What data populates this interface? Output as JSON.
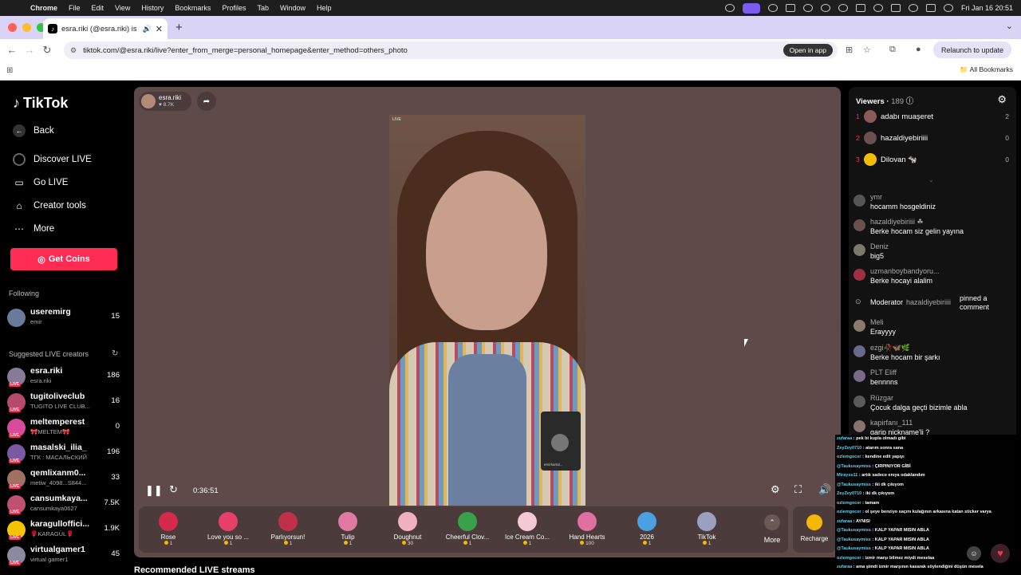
{
  "menubar": {
    "app": "Chrome",
    "items": [
      "File",
      "Edit",
      "View",
      "History",
      "Bookmarks",
      "Profiles",
      "Tab",
      "Window",
      "Help"
    ],
    "clock": "Fri Jan 16  20:51"
  },
  "tab": {
    "title": "esra.riki (@esra.riki) is LIVE"
  },
  "address": {
    "url": "tiktok.com/@esra.riki/live?enter_from_merge=personal_homepage&enter_method=others_photo",
    "open_in_app": "Open in app",
    "relaunch": "Relaunch to update"
  },
  "bookmarks": {
    "all": "All Bookmarks"
  },
  "sidebar": {
    "logo": "TikTok",
    "back": "Back",
    "nav": [
      "Discover LIVE",
      "Go LIVE",
      "Creator tools",
      "More"
    ],
    "get_coins": "Get Coins",
    "following_title": "Following",
    "following": [
      {
        "name": "useremirg",
        "sub": "emir",
        "count": "15"
      }
    ],
    "suggested_title": "Suggested LIVE creators",
    "suggested": [
      {
        "name": "esra.riki",
        "sub": "esra.riki",
        "count": "186"
      },
      {
        "name": "tugitoliveclub",
        "sub": "TUGITO LIVE CLUB...",
        "count": "16"
      },
      {
        "name": "meltemperest",
        "sub": "🎀MELTEM🎀",
        "count": "0"
      },
      {
        "name": "masalski_ilia_",
        "sub": "ТГК : МАСАЛЬСКИЙ",
        "count": "196"
      },
      {
        "name": "qemlixanm0...",
        "sub": "metiw_4098...S844...",
        "count": "33"
      },
      {
        "name": "cansumkaya...",
        "sub": "cansumkaya0627",
        "count": "7.5K"
      },
      {
        "name": "karagulloffici...",
        "sub": "🌹KARAGÜL🌹",
        "count": "1.9K"
      },
      {
        "name": "virtualgamer1",
        "sub": "virtual gamer1",
        "count": "45"
      }
    ],
    "avatar_colors": [
      "#8a7a9a",
      "#b54a6a",
      "#d84a9a",
      "#7a5aa0",
      "#a07060",
      "#c05070",
      "#f5c400",
      "#8a8aa0"
    ]
  },
  "player": {
    "host": {
      "name": "esra.riki",
      "likes": "♥ 8.7K"
    },
    "live_tag": "LIVE",
    "pip_name": "emirkartal...",
    "time": "0:36:51",
    "gifts": [
      {
        "name": "Rose",
        "price": "1",
        "color": "#d62a4a"
      },
      {
        "name": "Love you so ...",
        "price": "1",
        "color": "#e8406a"
      },
      {
        "name": "Parlıyorsun!",
        "price": "1",
        "color": "#c0304a"
      },
      {
        "name": "Tulip",
        "price": "1",
        "color": "#e07aa0"
      },
      {
        "name": "Doughnut",
        "price": "30",
        "color": "#f0b0c0"
      },
      {
        "name": "Cheerful Clov...",
        "price": "1",
        "color": "#3aa04a"
      },
      {
        "name": "Ice Cream Co...",
        "price": "1",
        "color": "#f4c8d4"
      },
      {
        "name": "Hand Hearts",
        "price": "100",
        "color": "#e070a0"
      },
      {
        "name": "2026",
        "price": "1",
        "color": "#4aa0e0"
      },
      {
        "name": "TikTok",
        "price": "1",
        "color": "#9aa0c0"
      }
    ],
    "more": "More",
    "recharge": "Recharge"
  },
  "recommended": "Recommended LIVE streams",
  "viewers_panel": {
    "title": "Viewers",
    "count": "189",
    "top": [
      {
        "rank": "1",
        "name": "adabı muaşeret",
        "score": "2",
        "color": "#8a5a5a"
      },
      {
        "rank": "2",
        "name": "hazaldiyebiriiii",
        "score": "0",
        "color": "#6a5050"
      },
      {
        "rank": "3",
        "name": "Dilovan 🐄",
        "score": "0",
        "color": "#f0c000"
      }
    ],
    "comments": [
      {
        "user": "ymr",
        "text": "hocamm hosgeldiniz",
        "color": "#555"
      },
      {
        "user": "hazaldiyebiriiii ☘",
        "text": "Berke hocam siz gelin yayına",
        "color": "#6a5050"
      },
      {
        "user": "Deniz",
        "text": "big5",
        "color": "#7a7a6a"
      },
      {
        "user": "uzmanboybandyoru...",
        "text": "Berke hocayi alalim",
        "color": "#a03040"
      }
    ],
    "pinned": {
      "role": "Moderator",
      "user": "hazaldiyebiriiii",
      "action": "pinned a comment"
    },
    "comments2": [
      {
        "user": "Meli",
        "text": "Erayyyy",
        "color": "#8a7a6a"
      },
      {
        "user": "ezgi🥀🦋🌿",
        "text": "Berke hocam bir şarkı",
        "color": "#6a6a8a"
      },
      {
        "user": "PLT Eliff",
        "text": "bennnns",
        "color": "#7a6a8a"
      },
      {
        "user": "Rüzgar",
        "text": "Çocuk dalga geçti bizimle abla",
        "color": "#5a5a5a"
      },
      {
        "user": "kapirfanı_111",
        "text": "garip nickname'li ?",
        "color": "#8a7070"
      }
    ]
  },
  "overlay": [
    {
      "user": "zufaraa",
      "text": "pek bi kupla olmadı gibi"
    },
    {
      "user": "ZeyZey0710",
      "text": "atarım sonra sana"
    },
    {
      "user": "ozlemgocer",
      "text": "kendine edit yapıyı"
    },
    {
      "user": "@Taukusaymiss",
      "text": "ÇIRPINIYOR GİBİ"
    },
    {
      "user": "Mirayss11",
      "text": "artık sadece enıya odaklandım"
    },
    {
      "user": "@Taukusaymiss",
      "text": "iki dk çıkıyom"
    },
    {
      "user": "ZeyZey0710",
      "text": "iki dk çıkıyom"
    },
    {
      "user": "ozlemgocer",
      "text": "tamam"
    },
    {
      "user": "ozlemgocer",
      "text": "ol şeye benziyo saçını kulağının arkasına katan sticker varya"
    },
    {
      "user": "zufaraa",
      "text": "AYNISI"
    },
    {
      "user": "@Taukusaymiss",
      "text": "KALP YAPAR MISIN ABLA"
    },
    {
      "user": "@Taukusaymiss",
      "text": "KALP YAPAR MISIN ABLA"
    },
    {
      "user": "@Taukusaymiss",
      "text": "KALP YAPAR MISIN ABLA"
    },
    {
      "user": "ozlemgocer",
      "text": "izmir marşı bilmez miydi meselaa"
    },
    {
      "user": "zufaraa",
      "text": "ama şimdi izmir marşının kasarak söylendiğini düşün mesela"
    }
  ]
}
